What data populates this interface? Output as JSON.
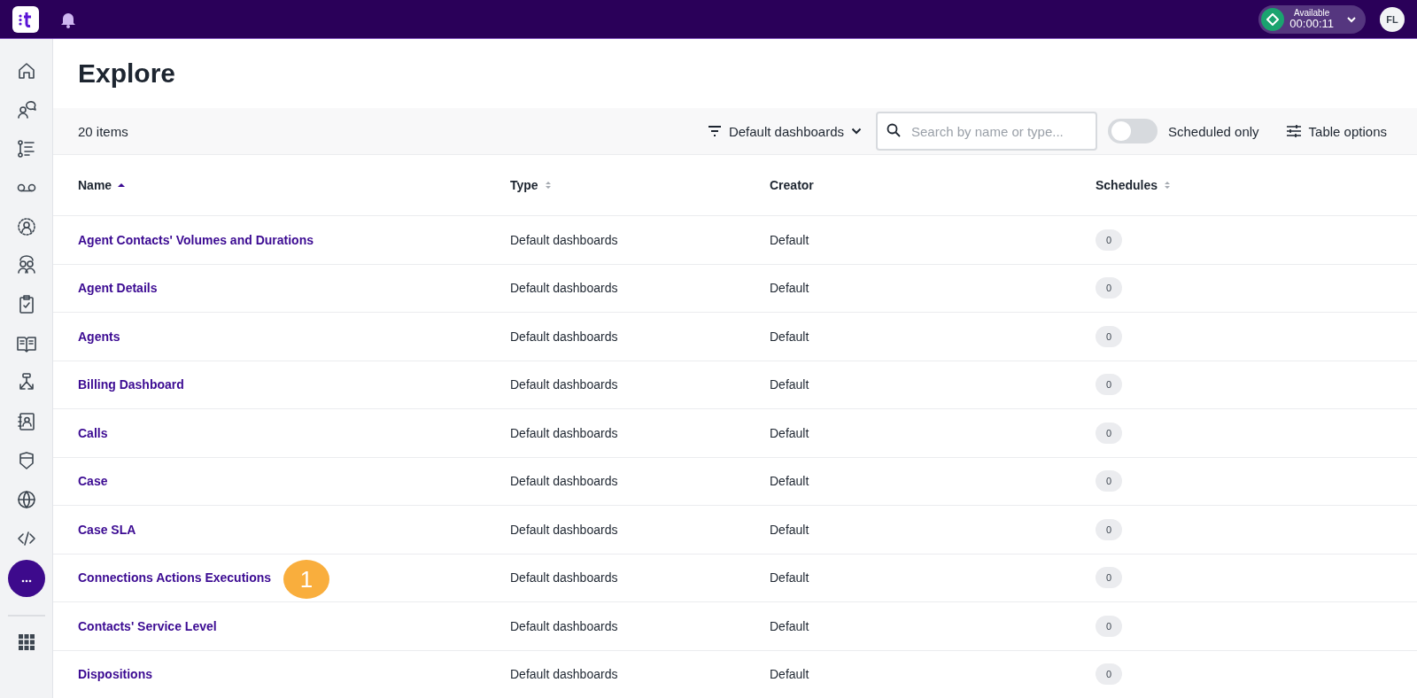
{
  "top_bar": {
    "status": {
      "label": "Available",
      "timer": "00:00:11"
    },
    "avatar": "FL"
  },
  "page": {
    "title": "Explore"
  },
  "toolbar": {
    "count": "20 items",
    "filter": "Default dashboards",
    "search": {
      "placeholder": "Search by name or type..."
    },
    "scheduled_only": {
      "label": "Scheduled only",
      "on": false
    },
    "table_options": "Table options"
  },
  "table": {
    "columns": [
      {
        "label": "Name",
        "sortable": true,
        "sorted": true
      },
      {
        "label": "Type",
        "sortable": true,
        "sorted": false
      },
      {
        "label": "Creator",
        "sortable": false,
        "sorted": false
      },
      {
        "label": "Schedules",
        "sortable": true,
        "sorted": false
      }
    ],
    "rows": [
      {
        "name": "Agent Contacts' Volumes and Durations",
        "type": "Default dashboards",
        "creator": "Default",
        "schedules": "0"
      },
      {
        "name": "Agent Details",
        "type": "Default dashboards",
        "creator": "Default",
        "schedules": "0"
      },
      {
        "name": "Agents",
        "type": "Default dashboards",
        "creator": "Default",
        "schedules": "0"
      },
      {
        "name": "Billing Dashboard",
        "type": "Default dashboards",
        "creator": "Default",
        "schedules": "0"
      },
      {
        "name": "Calls",
        "type": "Default dashboards",
        "creator": "Default",
        "schedules": "0"
      },
      {
        "name": "Case",
        "type": "Default dashboards",
        "creator": "Default",
        "schedules": "0"
      },
      {
        "name": "Case SLA",
        "type": "Default dashboards",
        "creator": "Default",
        "schedules": "0"
      },
      {
        "name": "Connections Actions Executions",
        "type": "Default dashboards",
        "creator": "Default",
        "schedules": "0",
        "callout": "1"
      },
      {
        "name": "Contacts' Service Level",
        "type": "Default dashboards",
        "creator": "Default",
        "schedules": "0"
      },
      {
        "name": "Dispositions",
        "type": "Default dashboards",
        "creator": "Default",
        "schedules": "0"
      }
    ]
  }
}
